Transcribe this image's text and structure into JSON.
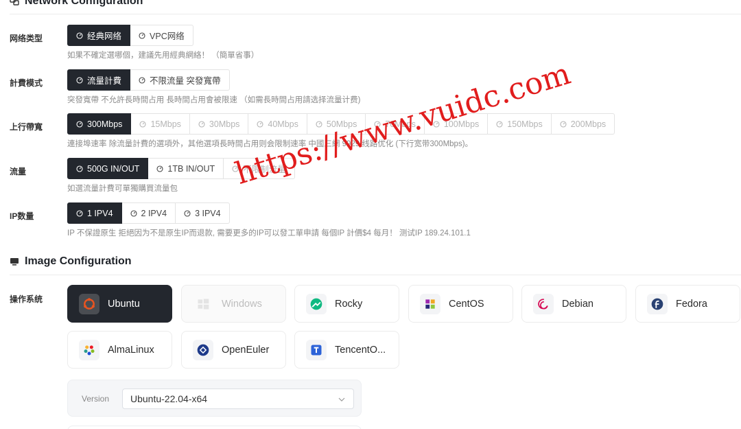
{
  "network_section": {
    "title": "Network Configuration",
    "icon": "network-icon"
  },
  "rows": [
    {
      "label": "网络类型",
      "options": [
        {
          "label": "经典网络",
          "state": "active"
        },
        {
          "label": "VPC网络",
          "state": "normal"
        }
      ],
      "hint": "如果不確定選哪個，建議先用經典網絡！ （簡單省事）"
    },
    {
      "label": "計費模式",
      "options": [
        {
          "label": "流量計費",
          "state": "active"
        },
        {
          "label": "不限流量 突發寬帶",
          "state": "normal"
        }
      ],
      "hint": "突發寬帶 不允許長時間占用 長時間占用會被限速 （如需長時間占用請选择流量计费)"
    },
    {
      "label": "上行帶寬",
      "options": [
        {
          "label": "300Mbps",
          "state": "active"
        },
        {
          "label": "15Mbps",
          "state": "disabled"
        },
        {
          "label": "30Mbps",
          "state": "disabled"
        },
        {
          "label": "40Mbps",
          "state": "disabled"
        },
        {
          "label": "50Mbps",
          "state": "disabled"
        },
        {
          "label": "70Mbps",
          "state": "disabled"
        },
        {
          "label": "100Mbps",
          "state": "disabled"
        },
        {
          "label": "150Mbps",
          "state": "disabled"
        },
        {
          "label": "200Mbps",
          "state": "disabled"
        }
      ],
      "hint": "連接埠速率 除流量計費的選項外，其他選項長時間占用则会限制速率 中國三網 9929 线路优化 (下行宽带300Mbps)。"
    },
    {
      "label": "流量",
      "options": [
        {
          "label": "500G IN/OUT",
          "state": "active"
        },
        {
          "label": "1TB IN/OUT",
          "state": "normal"
        },
        {
          "label": "不限制流量",
          "state": "disabled"
        }
      ],
      "hint": "如選流量計費可單獨購買流量包"
    },
    {
      "label": "IP数量",
      "options": [
        {
          "label": "1 IPV4",
          "state": "active"
        },
        {
          "label": "2 IPV4",
          "state": "normal"
        },
        {
          "label": "3 IPV4",
          "state": "normal"
        }
      ],
      "hint": "IP 不保證原生 拒絕因为不是原生IP而退款, 需要更多的IP可以發工單申請 每個IP 計價$4 每月！ 测试IP 189.24.101.1"
    }
  ],
  "image_section": {
    "title": "Image Configuration",
    "icon": "monitor-icon"
  },
  "os": {
    "label": "操作系统",
    "items": [
      {
        "name": "Ubuntu",
        "state": "active",
        "icon": "ubuntu-icon"
      },
      {
        "name": "Windows",
        "state": "disabled",
        "icon": "windows-icon"
      },
      {
        "name": "Rocky",
        "state": "normal",
        "icon": "rocky-icon"
      },
      {
        "name": "CentOS",
        "state": "normal",
        "icon": "centos-icon"
      },
      {
        "name": "Debian",
        "state": "normal",
        "icon": "debian-icon"
      },
      {
        "name": "Fedora",
        "state": "normal",
        "icon": "fedora-icon"
      },
      {
        "name": "AlmaLinux",
        "state": "normal",
        "icon": "almalinux-icon"
      },
      {
        "name": "OpenEuler",
        "state": "normal",
        "icon": "openeuler-icon"
      },
      {
        "name": "TencentO...",
        "state": "normal",
        "icon": "tencentos-icon"
      }
    ]
  },
  "version": {
    "label": "Version",
    "value": "Ubuntu-22.04-x64"
  },
  "watermark": "https://www.vuidc.com",
  "colors": {
    "active_bg": "#23272e",
    "watermark": "#e11d1d",
    "ubuntu": "#e95420",
    "fedora": "#294172",
    "debian": "#d70a53",
    "rocky": "#10b981",
    "openeuler": "#1e3a8a",
    "tencentos": "#2d63d8"
  }
}
